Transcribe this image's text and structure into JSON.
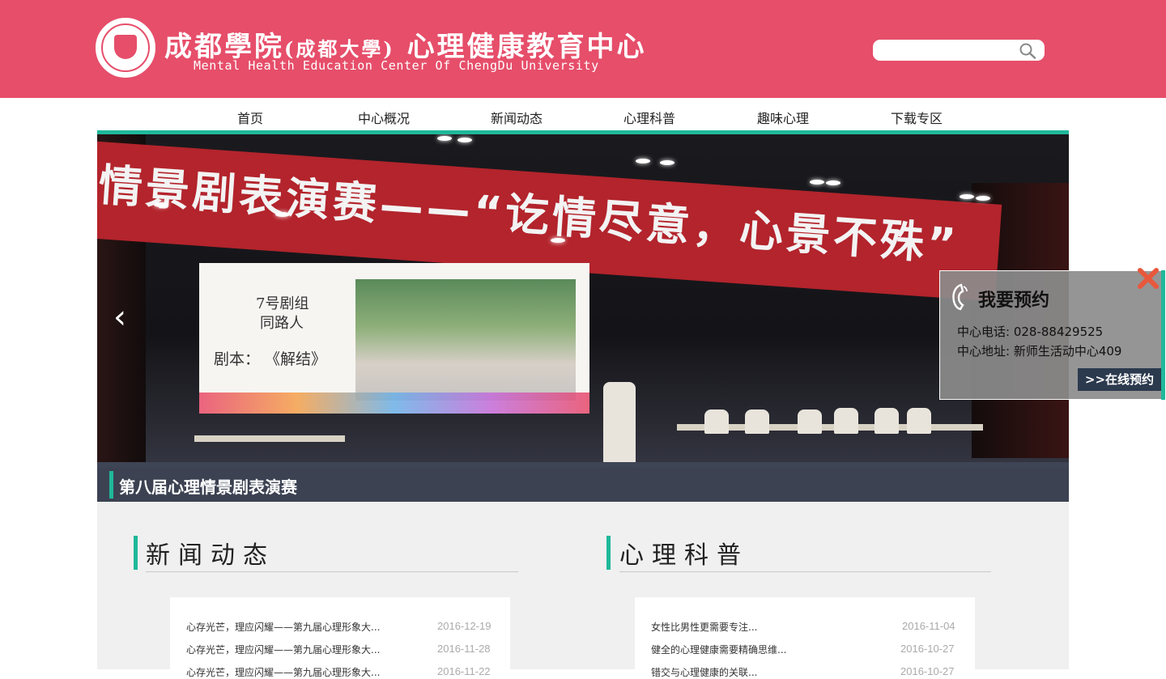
{
  "header": {
    "title_main": "成都學院",
    "title_paren": "(成都大學)",
    "title_center": "心理健康教育中心",
    "subtitle": "Mental Health Education Center Of ChengDu University",
    "search": {
      "placeholder": "",
      "value": ""
    }
  },
  "nav": {
    "items": [
      {
        "label": "首页"
      },
      {
        "label": "中心概况"
      },
      {
        "label": "新闻动态"
      },
      {
        "label": "心理科普"
      },
      {
        "label": "趣味心理"
      },
      {
        "label": "下载专区"
      }
    ]
  },
  "banner": {
    "stage_banner_text": "情景剧表演赛——“讫情尽意，心景不殊”",
    "screen_line1": "7号剧组",
    "screen_line2": "同路人",
    "screen_line3": "剧本：  《解结》",
    "caption": "第八届心理情景剧表演赛",
    "prev_arrow": "‹"
  },
  "sections": {
    "news": {
      "title": "新闻动态",
      "items": [
        {
          "title": "心存光芒，理应闪耀——第九届心理形象大...",
          "date": "2016-12-19"
        },
        {
          "title": "心存光芒，理应闪耀——第九届心理形象大...",
          "date": "2016-11-28"
        },
        {
          "title": "心存光芒，理应闪耀——第九届心理形象大...",
          "date": "2016-11-22"
        }
      ]
    },
    "science": {
      "title": "心理科普",
      "items": [
        {
          "title": "女性比男性更需要专注...",
          "date": "2016-11-04"
        },
        {
          "title": "健全的心理健康需要精确思维...",
          "date": "2016-10-27"
        },
        {
          "title": "错交与心理健康的关联...",
          "date": "2016-10-27"
        }
      ]
    }
  },
  "appointment": {
    "title": "我要预约",
    "phone_line": "中心电话: 028-88429525",
    "address_line": "中心地址: 新师生活动中心409",
    "button": ">>在线预约"
  },
  "colors": {
    "header_bg": "#e64e6a",
    "accent": "#1fb89a",
    "button_bg": "#2c3a4e"
  },
  "icons": {
    "search": "search-icon",
    "close": "close-icon",
    "phone": "phone-icon",
    "prev": "chevron-left-icon"
  }
}
